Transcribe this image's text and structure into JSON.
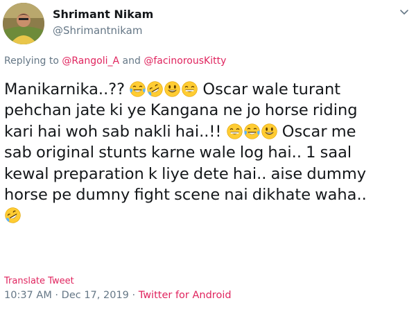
{
  "user": {
    "display_name": "Shrimant Nikam",
    "handle": "@Shrimantnikam",
    "avatar_icon": "profile-photo"
  },
  "menu_icon": "chevron-down-icon",
  "reply": {
    "prefix": "Replying to ",
    "mention1": "@Rangoli_A",
    "joiner": " and ",
    "mention2": "@facinorousKitty"
  },
  "tweet": {
    "line1_a": "Manikarnika..??",
    "line1_b": " Oscar wale turant",
    "line2": "pehchan jate ki ye Kangana ne jo horse riding",
    "line3_a": "kari hai woh sab nakli hai..!!",
    "line3_b": " Oscar me",
    "line4": "sab original stunts karne wale log hai.. 1 saal",
    "line5": "kewal preparation k liye dete hai.. aise dummy",
    "line6": "horse pe dumny fight scene nai dikhate waha..",
    "emojis_line1": [
      "face-with-tears-of-joy",
      "rolling-on-the-floor-laughing",
      "smiling-face",
      "grinning-face-with-smiling-eyes"
    ],
    "emojis_line3": [
      "grinning-face-with-smiling-eyes",
      "face-with-tears-of-joy",
      "smiling-face"
    ],
    "emojis_line7": [
      "rolling-on-the-floor-laughing"
    ]
  },
  "translate_label": "Translate Tweet",
  "meta": {
    "time": "10:37 AM",
    "sep1": " · ",
    "date": "Dec 17, 2019",
    "sep2": " · ",
    "source": "Twitter for Android"
  },
  "colors": {
    "link": "#e0245e",
    "secondary": "#657786",
    "text": "#14171a",
    "emoji_face": "#ffcc33"
  }
}
